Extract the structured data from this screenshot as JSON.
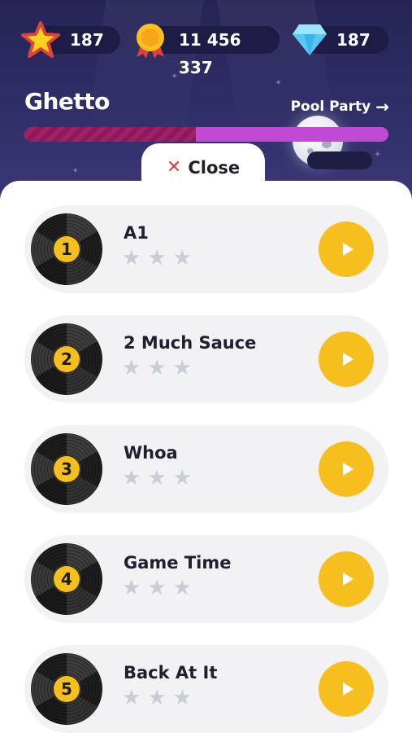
{
  "stats": {
    "stars": {
      "value": "187",
      "icon": "star-icon"
    },
    "coins": {
      "value": "11 456 337",
      "icon": "medal-icon"
    },
    "gems": {
      "value": "187",
      "icon": "diamond-icon"
    }
  },
  "level": {
    "title": "Ghetto",
    "next_label": "Pool Party",
    "next_icon": "arrow-right-icon",
    "progress_percent": 47
  },
  "sheet": {
    "close_label": "Close",
    "close_icon": "close-icon"
  },
  "songs": [
    {
      "number": "1",
      "title": "A1",
      "stars_earned": 0,
      "stars_total": 3
    },
    {
      "number": "2",
      "title": "2 Much Sauce",
      "stars_earned": 0,
      "stars_total": 3
    },
    {
      "number": "3",
      "title": "Whoa",
      "stars_earned": 0,
      "stars_total": 3
    },
    {
      "number": "4",
      "title": "Game Time",
      "stars_earned": 0,
      "stars_total": 3
    },
    {
      "number": "5",
      "title": "Back At It",
      "stars_earned": 0,
      "stars_total": 3
    }
  ],
  "colors": {
    "sky": "#2e2d66",
    "accent_yellow": "#f7bf1d",
    "progress_track": "#c04ad4",
    "progress_fill": "#a02168",
    "close_icon": "#e0413f",
    "star_empty": "#c9cdd6"
  }
}
